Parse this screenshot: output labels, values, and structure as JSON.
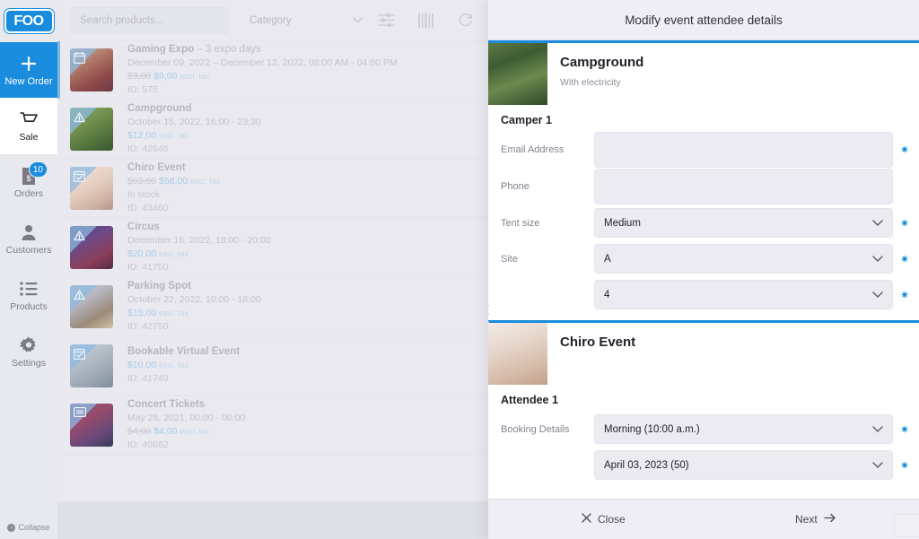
{
  "sidebar": {
    "logo_text": "FOO",
    "items": [
      {
        "label": "New Order",
        "icon": "plus-icon",
        "style": "primary"
      },
      {
        "label": "Sale",
        "icon": "cart-icon",
        "style": "active"
      },
      {
        "label": "Orders",
        "icon": "receipt-icon",
        "badge": "10"
      },
      {
        "label": "Customers",
        "icon": "user-icon"
      },
      {
        "label": "Products",
        "icon": "list-icon"
      },
      {
        "label": "Settings",
        "icon": "gear-icon"
      }
    ],
    "collapse_label": "Collapse"
  },
  "toolbar": {
    "search_placeholder": "Search products...",
    "category_label": "Category",
    "icons": [
      "filter-sliders-icon",
      "barcode-icon",
      "refresh-icon"
    ]
  },
  "products": [
    {
      "title": "Gaming Expo",
      "subtitle": "– 3 expo days",
      "date": "December 09, 2022 – December 12, 2022, 08:00 AM - 04:00 PM",
      "price_old": "$9,00",
      "price_new": "$9,00",
      "tax": "excl. tax",
      "id": "ID: 575",
      "stock": "",
      "thumb_icon": "calendar-icon",
      "selected": true
    },
    {
      "title": "Campground",
      "subtitle": "",
      "date": "October 15, 2022, 16:00 - 23:30",
      "price_old": "",
      "price_new": "$12,00",
      "tax": "excl. tax",
      "id": "ID: 42646",
      "stock": "",
      "thumb_icon": "tent-icon",
      "selected": false
    },
    {
      "title": "Chiro Event",
      "subtitle": "",
      "date": "",
      "price_old": "$63,00",
      "price_new": "$58,00",
      "tax": "excl. tax",
      "id": "ID: 43460",
      "stock": "In stock",
      "thumb_icon": "calendar-check-icon",
      "selected": false
    },
    {
      "title": "Circus",
      "subtitle": "",
      "date": "December 16, 2022, 18:00 - 20:00",
      "price_old": "",
      "price_new": "$20,00",
      "tax": "excl. tax",
      "id": "ID: 41750",
      "stock": "",
      "thumb_icon": "tent-icon",
      "selected": false
    },
    {
      "title": "Parking Spot",
      "subtitle": "",
      "date": "October 22, 2022, 10:00 - 18:00",
      "price_old": "",
      "price_new": "$15,00",
      "tax": "excl. tax",
      "id": "ID: 42750",
      "stock": "",
      "thumb_icon": "tent-icon",
      "selected": false
    },
    {
      "title": "Bookable Virtual Event",
      "subtitle": "",
      "date": "",
      "price_old": "",
      "price_new": "$10,00",
      "tax": "excl. tax",
      "id": "ID: 41749",
      "stock": "",
      "thumb_icon": "calendar-check-icon",
      "selected": false
    },
    {
      "title": "Concert Tickets",
      "subtitle": "",
      "date": "May 28, 2021, 00:00 - 00:00",
      "price_old": "$4,00",
      "price_new": "$4,00",
      "tax": "excl. tax",
      "id": "ID: 40862",
      "stock": "",
      "thumb_icon": "ticket-icon",
      "selected": false
    }
  ],
  "modal": {
    "title": "Modify event attendee details",
    "events": [
      {
        "name": "Campground",
        "subtitle": "With electricity",
        "attendee_label": "Camper 1",
        "fields": [
          {
            "label": "Email Address",
            "value": "",
            "type": "text",
            "required": true
          },
          {
            "label": "Phone",
            "value": "",
            "type": "text",
            "required": false
          },
          {
            "label": "Tent size",
            "value": "Medium",
            "type": "select",
            "required": true
          },
          {
            "label": "Site",
            "value": "A",
            "type": "select",
            "required": true
          },
          {
            "label": "",
            "value": "4",
            "type": "select",
            "required": true
          }
        ]
      },
      {
        "name": "Chiro Event",
        "subtitle": "",
        "attendee_label": "Attendee 1",
        "fields": [
          {
            "label": "Booking Details",
            "value": "Morning (10:00 a.m.)",
            "type": "select",
            "required": true
          },
          {
            "label": "",
            "value": "April 03, 2023 (50)",
            "type": "select",
            "required": true
          }
        ]
      }
    ],
    "footer": {
      "close_label": "Close",
      "next_label": "Next"
    }
  },
  "colors": {
    "accent": "#1a8cdd",
    "panel_bg": "#e9e9ef",
    "field_bg": "#ebebf1"
  }
}
